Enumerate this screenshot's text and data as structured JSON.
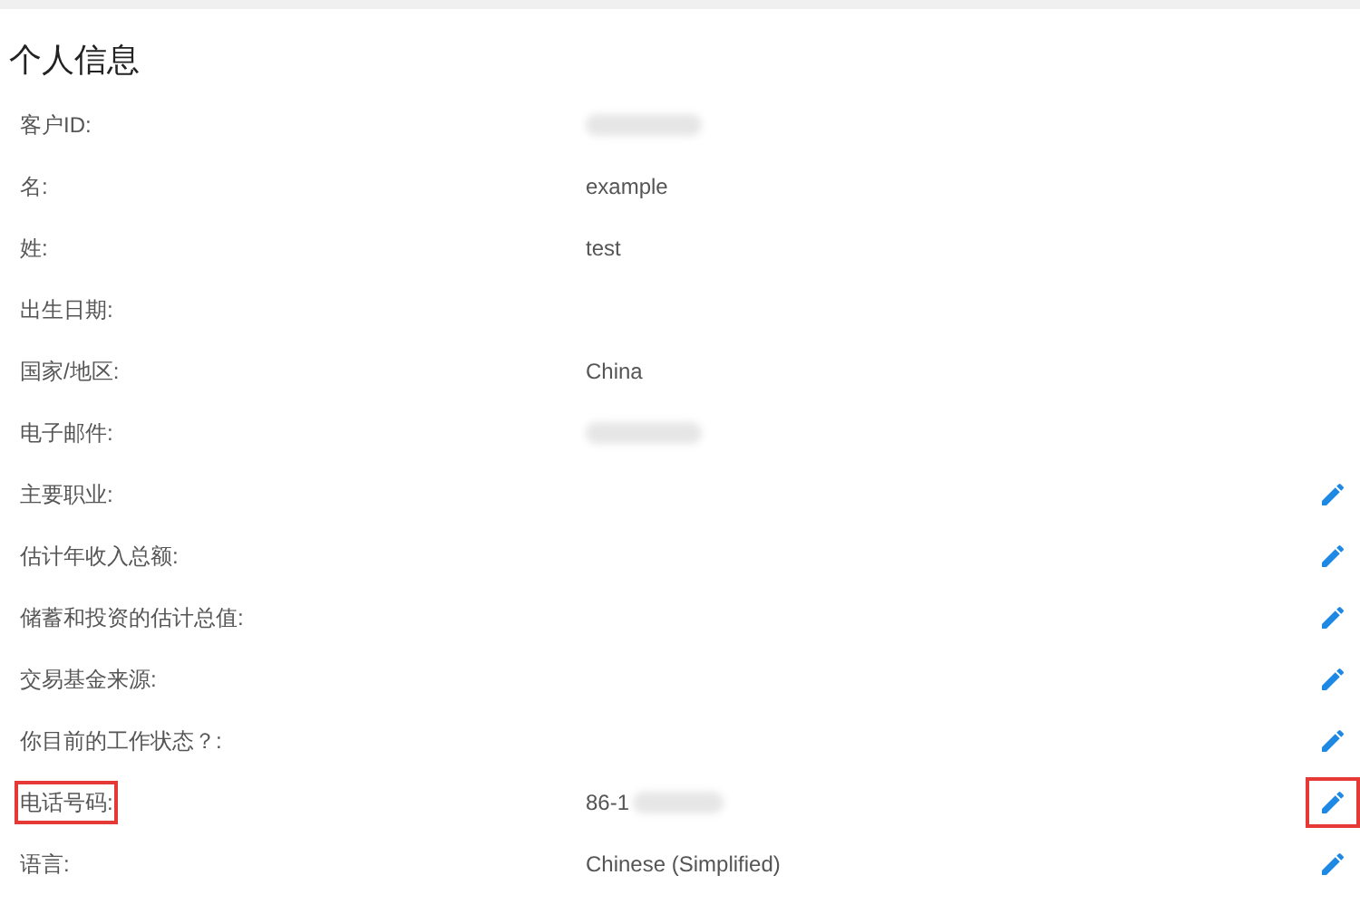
{
  "title": "个人信息",
  "rows": [
    {
      "label": "客户ID:",
      "redacted": true,
      "editable": false,
      "highlighted": false
    },
    {
      "label": "名:",
      "value": "example",
      "redacted": false,
      "editable": false,
      "highlighted": false
    },
    {
      "label": "姓:",
      "value": "test",
      "redacted": false,
      "editable": false,
      "highlighted": false
    },
    {
      "label": "出生日期:",
      "redacted": false,
      "editable": false,
      "highlighted": false
    },
    {
      "label": "国家/地区:",
      "value": "China",
      "redacted": false,
      "editable": false,
      "highlighted": false
    },
    {
      "label": "电子邮件:",
      "redacted": true,
      "editable": false,
      "highlighted": false
    },
    {
      "label": "主要职业:",
      "redacted": false,
      "editable": true,
      "highlighted": false
    },
    {
      "label": "估计年收入总额:",
      "redacted": false,
      "editable": true,
      "highlighted": false
    },
    {
      "label": "储蓄和投资的估计总值:",
      "redacted": false,
      "editable": true,
      "highlighted": false
    },
    {
      "label": "交易基金来源:",
      "redacted": false,
      "editable": true,
      "highlighted": false
    },
    {
      "label": "你目前的工作状态？:",
      "redacted": false,
      "editable": true,
      "highlighted": false
    },
    {
      "label": "电话号码:",
      "value": "86-1",
      "redacted": true,
      "editable": true,
      "highlighted": true
    },
    {
      "label": "语言:",
      "value": "Chinese (Simplified)",
      "redacted": false,
      "editable": true,
      "highlighted": false
    }
  ]
}
